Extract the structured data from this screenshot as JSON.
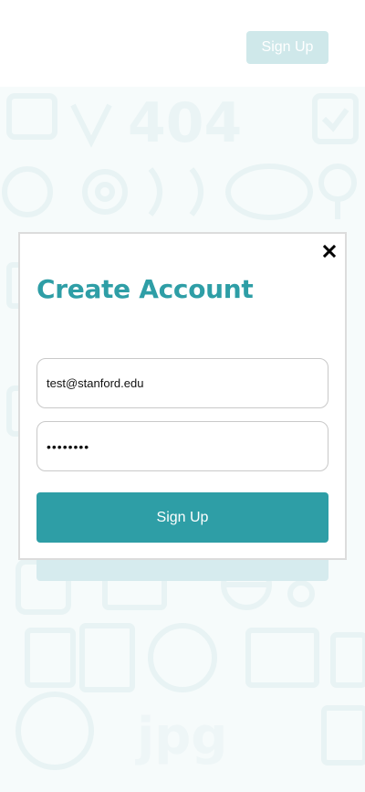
{
  "header": {
    "signup_label": "Sign Up"
  },
  "modal": {
    "title": "Create Account",
    "email_value": "test@stanford.edu",
    "password_value": "••••••••",
    "submit_label": "Sign Up",
    "close_icon": "close-icon"
  },
  "colors": {
    "accent": "#2e9ea6",
    "accent_light": "#cfe8ea",
    "background_pattern": "#f6fbfb"
  }
}
